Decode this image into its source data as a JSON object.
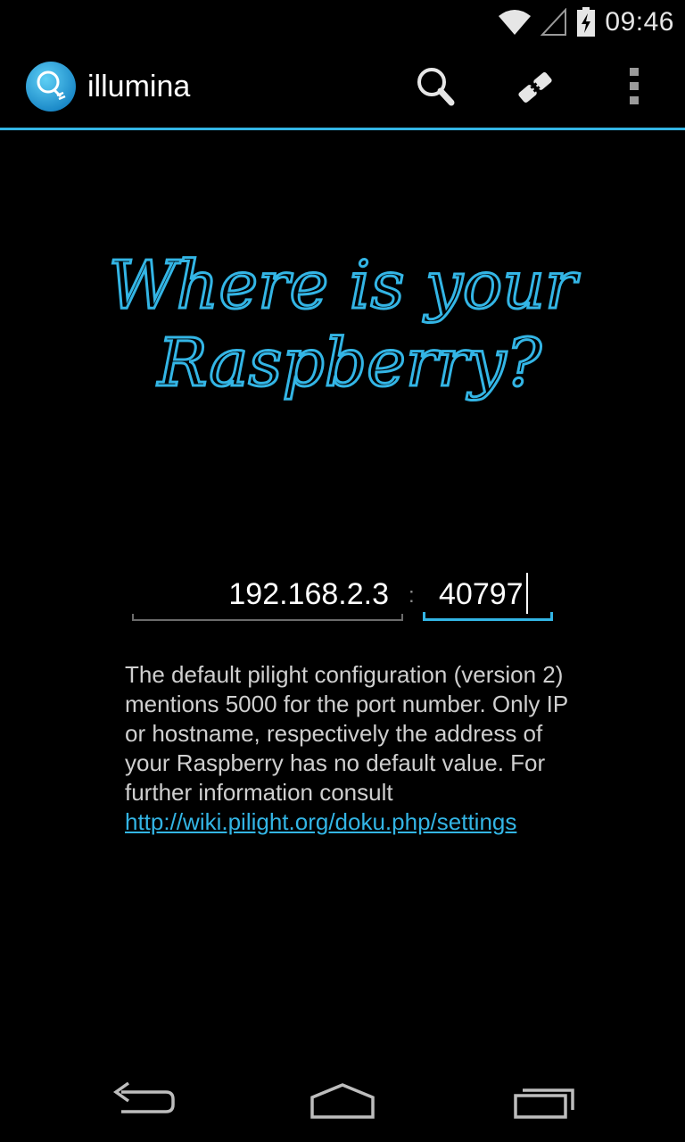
{
  "status_bar": {
    "time": "09:46",
    "icons": [
      "wifi-icon",
      "cell-signal-icon",
      "battery-charging-icon"
    ]
  },
  "action_bar": {
    "title": "illumina",
    "actions": [
      "search-icon",
      "plug-icon",
      "overflow-menu-icon"
    ],
    "accent_color": "#33b5e5"
  },
  "heading": {
    "line1": "Where is your",
    "line2": "Raspberry?"
  },
  "connection_form": {
    "host_value": "192.168.2.3",
    "separator": ":",
    "port_value": "40797"
  },
  "description": {
    "text": "The default pilight configuration (version 2) mentions 5000 for the port number. Only IP or hostname, respectively the address of your Raspberry has no default value. For further information consult ",
    "link_text": "http://wiki.pilight.org/doku.php/settings"
  },
  "nav_bar": {
    "buttons": [
      "back-icon",
      "home-icon",
      "recents-icon"
    ]
  }
}
